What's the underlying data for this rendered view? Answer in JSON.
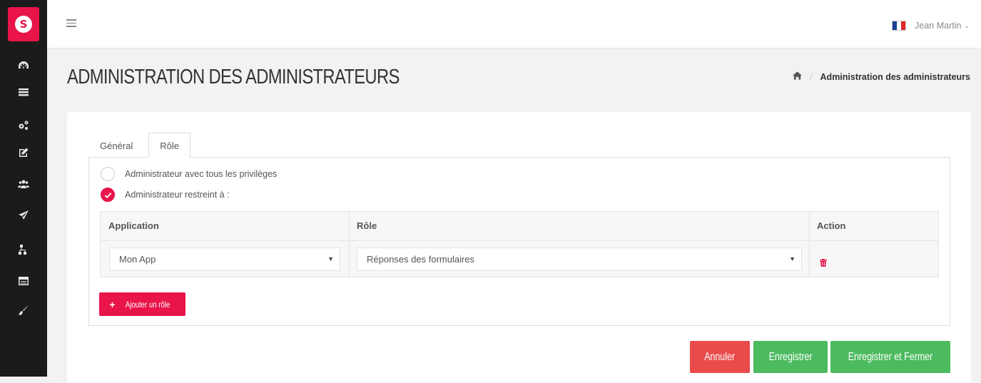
{
  "app": {
    "logo_letter": "S",
    "accent": "#e8144a"
  },
  "sidebar": {
    "icons": [
      "dashboard-icon",
      "list-icon",
      "cogs-icon",
      "edit-icon",
      "users-icon",
      "send-icon",
      "sitemap-icon",
      "table-icon",
      "brush-icon"
    ]
  },
  "header": {
    "user_name": "Jean Martin",
    "user_chevron": "⌄",
    "language_flag": "french-flag-icon"
  },
  "page": {
    "title": "ADMINISTRATION DES ADMINISTRATEURS",
    "breadcrumb": {
      "separator": "/",
      "current": "Administration des administrateurs"
    }
  },
  "tabs": [
    {
      "label": "Général",
      "active": false
    },
    {
      "label": "Rôle",
      "active": true
    }
  ],
  "role": {
    "option_all": "Administrateur avec tous les privilèges",
    "option_restricted": "Administrateur restreint à :",
    "selected": "restricted",
    "table": {
      "headers": {
        "application": "Application",
        "role": "Rôle",
        "action": "Action"
      },
      "rows": [
        {
          "application": "Mon App",
          "role": "Réponses des formulaires"
        }
      ]
    },
    "add_button": "Ajouter un rôle"
  },
  "footer": {
    "cancel": "Annuler",
    "save": "Enregistrer",
    "save_close": "Enregistrer et Fermer"
  },
  "colors": {
    "danger": "#e94b4b",
    "success": "#4cba5e",
    "sidebar": "#1b1b1b"
  }
}
